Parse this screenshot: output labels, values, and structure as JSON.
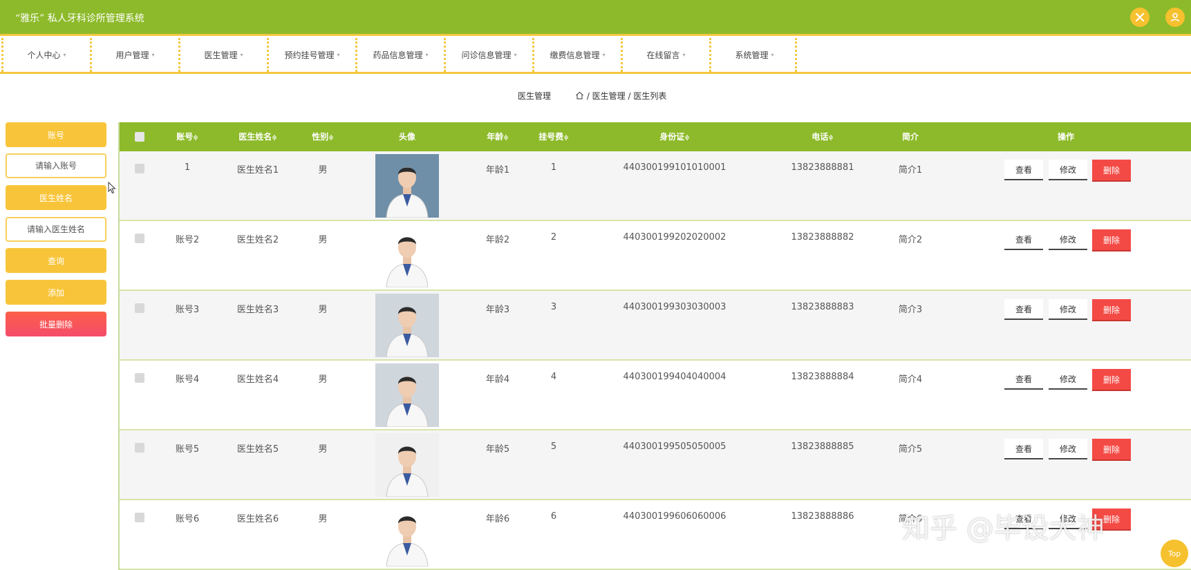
{
  "header": {
    "title": "“雅乐” 私人牙科诊所管理系统",
    "close_icon": "close-icon",
    "user_icon": "user-icon",
    "accent": "#8dba2a",
    "gold": "#f4c73e"
  },
  "nav": {
    "items": [
      "个人中心",
      "用户管理",
      "医生管理",
      "预约挂号管理",
      "药品信息管理",
      "问诊信息管理",
      "缴费信息管理",
      "在线留言",
      "系统管理"
    ]
  },
  "breadcrumb": {
    "section": "医生管理",
    "path": "/ 医生管理 / 医生列表"
  },
  "sidebar": {
    "account_label": "账号",
    "account_placeholder": "请输入账号",
    "doctor_name_label": "医生姓名",
    "doctor_name_placeholder": "请输入医生姓名",
    "search_button": "查询",
    "add_button": "添加",
    "batch_delete_button": "批量删除"
  },
  "table": {
    "headers": {
      "account": "账号",
      "name": "医生姓名",
      "gender": "性别",
      "avatar": "头像",
      "age": "年龄",
      "fee": "挂号费",
      "id_card": "身份证",
      "phone": "电话",
      "intro": "简介",
      "actions": "操作"
    },
    "sort_icon": "≑",
    "actions": {
      "view": "查看",
      "edit": "修改",
      "delete": "删除"
    },
    "rows": [
      {
        "account": "1",
        "name": "医生姓名1",
        "gender": "男",
        "age": "年龄1",
        "fee": "1",
        "id_card": "440300199101010001",
        "phone": "13823888881",
        "intro": "简介1"
      },
      {
        "account": "账号2",
        "name": "医生姓名2",
        "gender": "男",
        "age": "年龄2",
        "fee": "2",
        "id_card": "440300199202020002",
        "phone": "13823888882",
        "intro": "简介2"
      },
      {
        "account": "账号3",
        "name": "医生姓名3",
        "gender": "男",
        "age": "年龄3",
        "fee": "3",
        "id_card": "440300199303030003",
        "phone": "13823888883",
        "intro": "简介3"
      },
      {
        "account": "账号4",
        "name": "医生姓名4",
        "gender": "男",
        "age": "年龄4",
        "fee": "4",
        "id_card": "440300199404040004",
        "phone": "13823888884",
        "intro": "简介4"
      },
      {
        "account": "账号5",
        "name": "医生姓名5",
        "gender": "男",
        "age": "年龄5",
        "fee": "5",
        "id_card": "440300199505050005",
        "phone": "13823888885",
        "intro": "简介5"
      },
      {
        "account": "账号6",
        "name": "医生姓名6",
        "gender": "男",
        "age": "年龄6",
        "fee": "6",
        "id_card": "440300199606060006",
        "phone": "13823888886",
        "intro": "简介6"
      }
    ]
  },
  "watermark": "知乎 @毕设大神",
  "top_button": "Top"
}
